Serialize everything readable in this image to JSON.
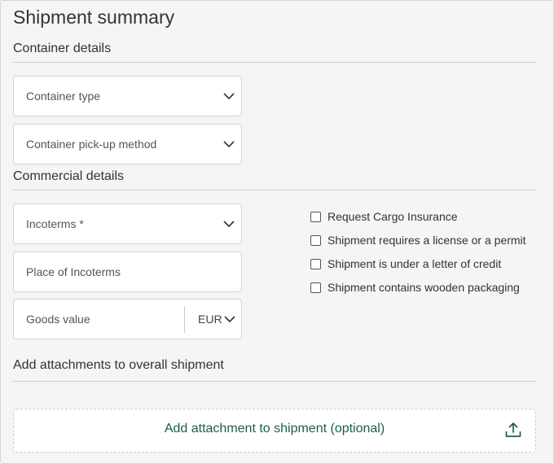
{
  "page": {
    "title": "Shipment summary"
  },
  "container_details": {
    "title": "Container details",
    "container_type": {
      "placeholder": "Container type"
    },
    "pickup_method": {
      "placeholder": "Container pick-up method"
    }
  },
  "commercial_details": {
    "title": "Commercial details",
    "incoterms": {
      "placeholder": "Incoterms *"
    },
    "place_of_incoterms": {
      "placeholder": "Place of Incoterms"
    },
    "goods_value": {
      "placeholder": "Goods value",
      "currency": "EUR"
    },
    "checkboxes": [
      {
        "label": "Request Cargo Insurance",
        "checked": false
      },
      {
        "label": "Shipment requires a license or a permit",
        "checked": false
      },
      {
        "label": "Shipment is under a letter of credit",
        "checked": false
      },
      {
        "label": "Shipment contains wooden packaging",
        "checked": false
      }
    ]
  },
  "attachments": {
    "title": "Add attachments to overall shipment",
    "dropzone_label": "Add attachment to shipment (optional)",
    "icon": "upload-icon"
  },
  "colors": {
    "accent": "#1b5e4f",
    "background": "#f5f5f5",
    "field_border": "#d4d4d4"
  }
}
